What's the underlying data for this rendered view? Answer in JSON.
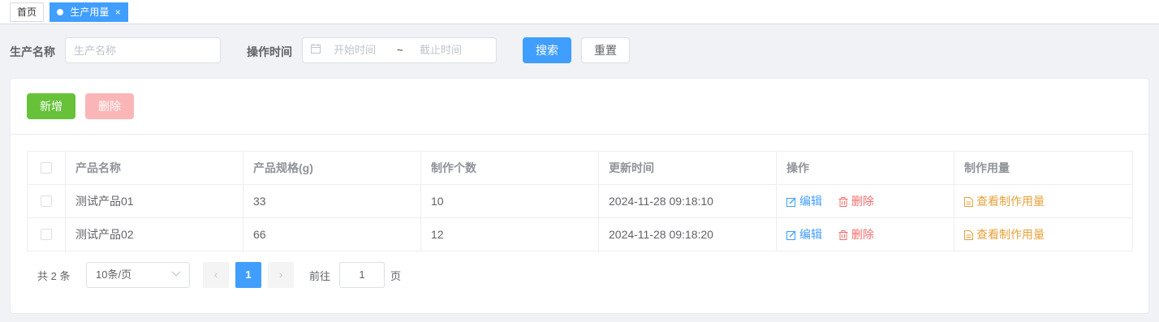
{
  "tags": {
    "home": "首页",
    "active": "生产用量",
    "close_symbol": "×"
  },
  "search": {
    "name_label": "生产名称",
    "name_placeholder": "生产名称",
    "time_label": "操作时间",
    "start_placeholder": "开始时间",
    "separator": "~",
    "end_placeholder": "截止时间",
    "search_button": "搜索",
    "reset_button": "重置"
  },
  "toolbar": {
    "add_button": "新增",
    "delete_button": "删除"
  },
  "table": {
    "headers": [
      "产品名称",
      "产品规格(g)",
      "制作个数",
      "更新时间",
      "操作",
      "制作用量"
    ],
    "rows": [
      {
        "name": "测试产品01",
        "spec": "33",
        "count": "10",
        "updated": "2024-11-28 09:18:10"
      },
      {
        "name": "测试产品02",
        "spec": "66",
        "count": "12",
        "updated": "2024-11-28 09:18:20"
      }
    ],
    "actions": {
      "edit": "编辑",
      "delete": "删除",
      "view_usage": "查看制作用量"
    }
  },
  "pagination": {
    "total": "共 2 条",
    "page_size": "10条/页",
    "prev": "‹",
    "current_page": "1",
    "next": "›",
    "goto_label": "前往",
    "goto_value": "1",
    "page_suffix": "页"
  },
  "colors": {
    "primary": "#409eff",
    "success": "#67c23a",
    "danger": "#f56c6c",
    "warning": "#e6a23c"
  }
}
